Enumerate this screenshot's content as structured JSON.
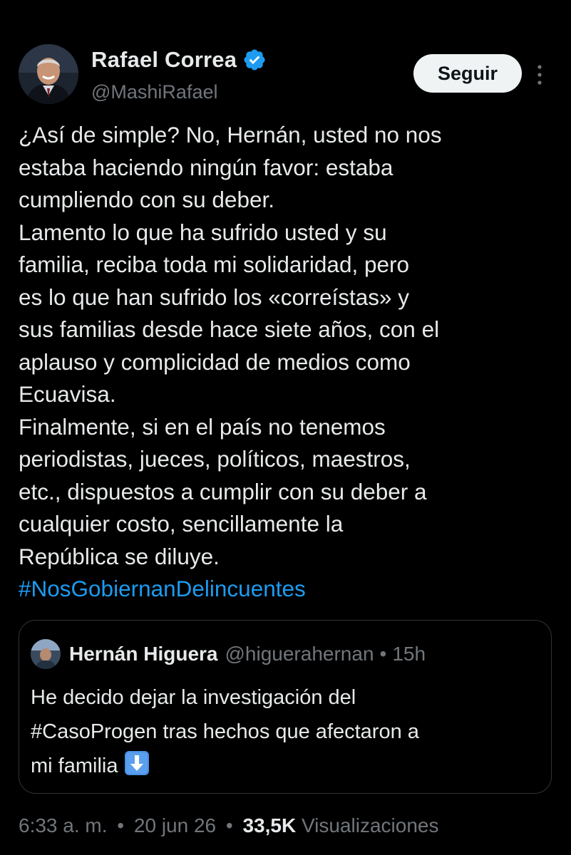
{
  "author": {
    "display_name": "Rafael Correa",
    "handle": "@MashiRafael",
    "verified": true,
    "follow_label": "Seguir"
  },
  "tweet": {
    "lines": [
      "¿Así de simple? No, Hernán, usted no nos",
      "estaba haciendo ningún favor: estaba",
      "cumpliendo con su deber.",
      "Lamento lo que ha sufrido usted y su",
      "familia, reciba toda mi solidaridad, pero",
      "es lo que han sufrido los «correístas» y",
      "sus familias desde hace siete años, con el",
      "aplauso y complicidad de medios como",
      "Ecuavisa.",
      "Finalmente, si en el país no tenemos",
      "periodistas, jueces, políticos, maestros,",
      "etc., dispuestos a cumplir con su deber a",
      "cualquier costo, sencillamente la",
      "República se diluye."
    ],
    "hashtag": "#NosGobiernanDelincuentes"
  },
  "quoted": {
    "display_name": "Hernán Higuera",
    "handle": "@higuerahernan",
    "separator": "•",
    "time": "15h",
    "lines": [
      "He decido dejar la investigación del",
      "#CasoProgen  tras hechos que afectaron a",
      "mi  familia"
    ],
    "emoji": "arrow-down-emoji"
  },
  "meta": {
    "time": "6:33 a. m.",
    "separator": "•",
    "date": "20 jun 26",
    "views_count": "33,5K",
    "views_label": "Visualizaciones"
  },
  "colors": {
    "background": "#000000",
    "text": "#e7e9ea",
    "secondary_text": "#71767b",
    "link": "#1d9bf0",
    "verified": "#1d9bf0",
    "border": "#2f3336",
    "follow_bg": "#eff3f4"
  }
}
